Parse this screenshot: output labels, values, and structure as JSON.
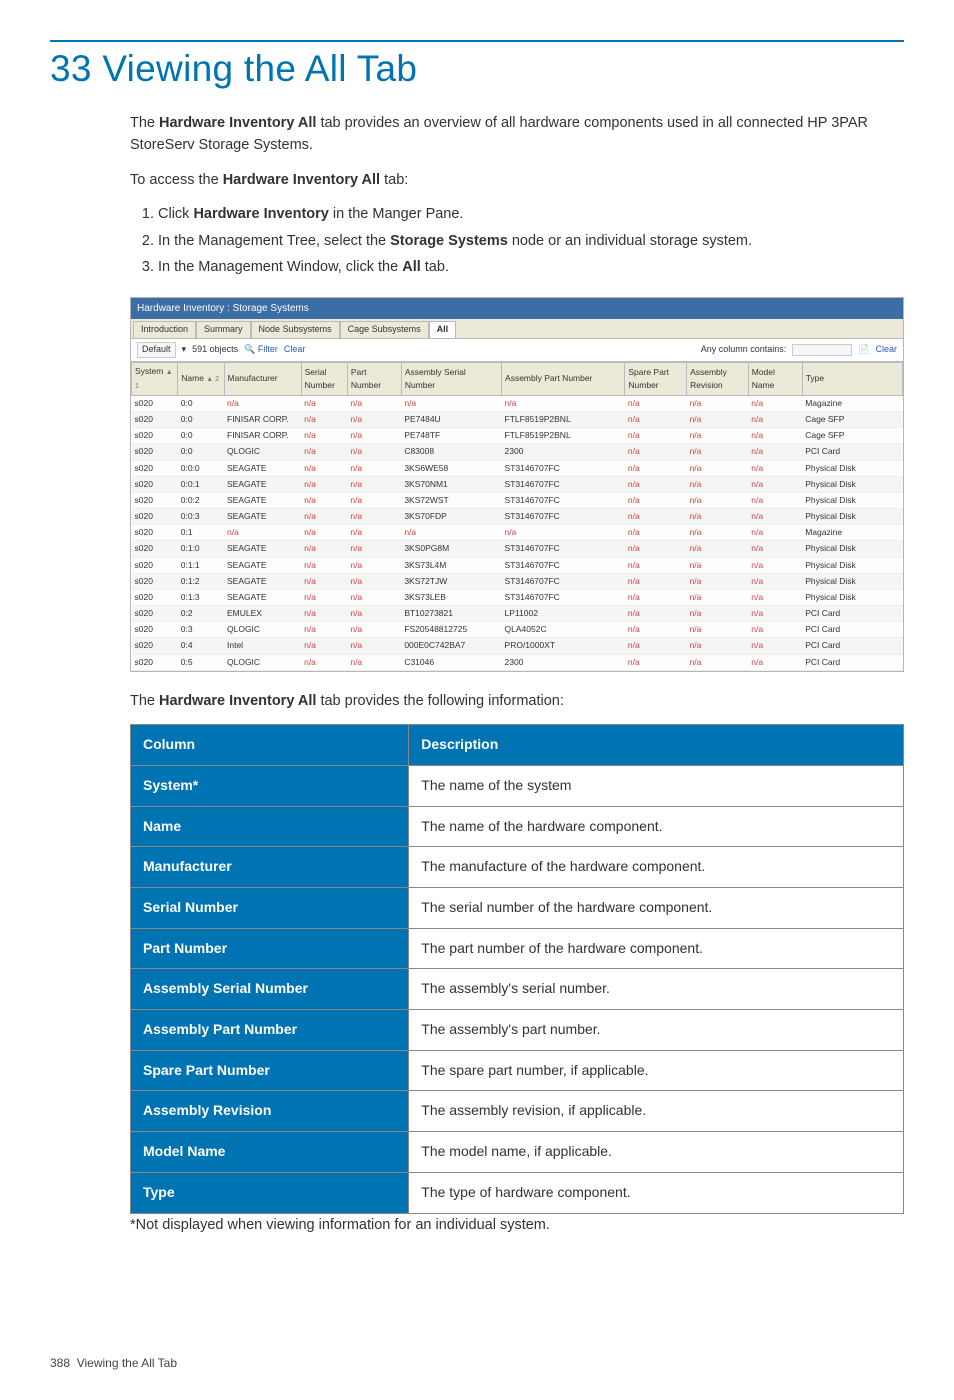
{
  "heading": "33 Viewing the All Tab",
  "intro1_pre": "The ",
  "intro1_bold": "Hardware Inventory All",
  "intro1_post": " tab provides an overview of all hardware components used in all connected HP 3PAR StoreServ Storage Systems.",
  "intro2_pre": "To access the ",
  "intro2_bold": "Hardware Inventory All",
  "intro2_post": " tab:",
  "steps": {
    "s1a": "Click ",
    "s1b": "Hardware Inventory",
    "s1c": " in the Manger Pane.",
    "s2a": "In the Management Tree, select the ",
    "s2b": "Storage Systems",
    "s2c": " node or an individual storage system.",
    "s3a": "In the Management Window, click the ",
    "s3b": "All",
    "s3c": " tab."
  },
  "post_img_pre": "The ",
  "post_img_bold": "Hardware Inventory All",
  "post_img_post": " tab provides the following information:",
  "footnote": "*Not displayed when viewing information for an individual system.",
  "footer_page": "388",
  "footer_label": "Viewing the All Tab",
  "screenshot": {
    "title": "Hardware Inventory : Storage Systems",
    "tabs": [
      "Introduction",
      "Summary",
      "Node Subsystems",
      "Cage Subsystems",
      "All"
    ],
    "selected_tab": "All",
    "toolbar": {
      "default_btn": "Default",
      "objects": "591 objects",
      "filter": "Filter",
      "clear": "Clear",
      "any_col_label": "Any column contains:",
      "any_col_value": "",
      "clear2": "Clear"
    },
    "columns": [
      "System",
      "Name",
      "Manufacturer",
      "Serial Number",
      "Part Number",
      "Assembly Serial Number",
      "Assembly Part Number",
      "Spare Part Number",
      "Assembly Revision",
      "Model Name",
      "Type"
    ],
    "sort1_idx": 0,
    "sort1_label": "1",
    "sort2_idx": 1,
    "sort2_label": "2",
    "rows": [
      [
        "s020",
        "0:0",
        "n/a",
        "n/a",
        "n/a",
        "n/a",
        "n/a",
        "n/a",
        "n/a",
        "n/a",
        "Magazine"
      ],
      [
        "s020",
        "0:0",
        "FINISAR CORP.",
        "n/a",
        "n/a",
        "PE7484U",
        "FTLF8519P2BNL",
        "n/a",
        "n/a",
        "n/a",
        "Cage SFP"
      ],
      [
        "s020",
        "0:0",
        "FINISAR CORP.",
        "n/a",
        "n/a",
        "PE748TF",
        "FTLF8519P2BNL",
        "n/a",
        "n/a",
        "n/a",
        "Cage SFP"
      ],
      [
        "s020",
        "0:0",
        "QLOGIC",
        "n/a",
        "n/a",
        "C83008",
        "2300",
        "n/a",
        "n/a",
        "n/a",
        "PCI Card"
      ],
      [
        "s020",
        "0:0:0",
        "SEAGATE",
        "n/a",
        "n/a",
        "3KS6WE58",
        "ST3146707FC",
        "n/a",
        "n/a",
        "n/a",
        "Physical Disk"
      ],
      [
        "s020",
        "0:0:1",
        "SEAGATE",
        "n/a",
        "n/a",
        "3KS70NM1",
        "ST3146707FC",
        "n/a",
        "n/a",
        "n/a",
        "Physical Disk"
      ],
      [
        "s020",
        "0:0:2",
        "SEAGATE",
        "n/a",
        "n/a",
        "3KS72WST",
        "ST3146707FC",
        "n/a",
        "n/a",
        "n/a",
        "Physical Disk"
      ],
      [
        "s020",
        "0:0:3",
        "SEAGATE",
        "n/a",
        "n/a",
        "3KS70FDP",
        "ST3146707FC",
        "n/a",
        "n/a",
        "n/a",
        "Physical Disk"
      ],
      [
        "s020",
        "0:1",
        "n/a",
        "n/a",
        "n/a",
        "n/a",
        "n/a",
        "n/a",
        "n/a",
        "n/a",
        "Magazine"
      ],
      [
        "s020",
        "0:1:0",
        "SEAGATE",
        "n/a",
        "n/a",
        "3KS0PG8M",
        "ST3146707FC",
        "n/a",
        "n/a",
        "n/a",
        "Physical Disk"
      ],
      [
        "s020",
        "0:1:1",
        "SEAGATE",
        "n/a",
        "n/a",
        "3KS73L4M",
        "ST3146707FC",
        "n/a",
        "n/a",
        "n/a",
        "Physical Disk"
      ],
      [
        "s020",
        "0:1:2",
        "SEAGATE",
        "n/a",
        "n/a",
        "3KS72TJW",
        "ST3146707FC",
        "n/a",
        "n/a",
        "n/a",
        "Physical Disk"
      ],
      [
        "s020",
        "0:1:3",
        "SEAGATE",
        "n/a",
        "n/a",
        "3KS73LEB",
        "ST3146707FC",
        "n/a",
        "n/a",
        "n/a",
        "Physical Disk"
      ],
      [
        "s020",
        "0:2",
        "EMULEX",
        "n/a",
        "n/a",
        "BT10273821",
        "LP11002",
        "n/a",
        "n/a",
        "n/a",
        "PCI Card"
      ],
      [
        "s020",
        "0:3",
        "QLOGIC",
        "n/a",
        "n/a",
        "FS20548812725",
        "QLA4052C",
        "n/a",
        "n/a",
        "n/a",
        "PCI Card"
      ],
      [
        "s020",
        "0:4",
        "Intel",
        "n/a",
        "n/a",
        "000E0C742BA7",
        "PRO/1000XT",
        "n/a",
        "n/a",
        "n/a",
        "PCI Card"
      ],
      [
        "s020",
        "0:5",
        "QLOGIC",
        "n/a",
        "n/a",
        "C31046",
        "2300",
        "n/a",
        "n/a",
        "n/a",
        "PCI Card"
      ]
    ]
  },
  "desc_table": {
    "header": [
      "Column",
      "Description"
    ],
    "rows": [
      [
        "System*",
        "The name of the system"
      ],
      [
        "Name",
        "The name of the hardware component."
      ],
      [
        "Manufacturer",
        "The manufacture of the hardware component."
      ],
      [
        "Serial Number",
        "The serial number of the hardware component."
      ],
      [
        "Part Number",
        "The part number of the hardware component."
      ],
      [
        "Assembly Serial Number",
        "The assembly's serial number."
      ],
      [
        "Assembly Part Number",
        "The assembly's part number."
      ],
      [
        "Spare Part Number",
        "The spare part number, if applicable."
      ],
      [
        "Assembly Revision",
        "The assembly revision, if applicable."
      ],
      [
        "Model Name",
        "The model name, if applicable."
      ],
      [
        "Type",
        "The type of hardware component."
      ]
    ]
  }
}
